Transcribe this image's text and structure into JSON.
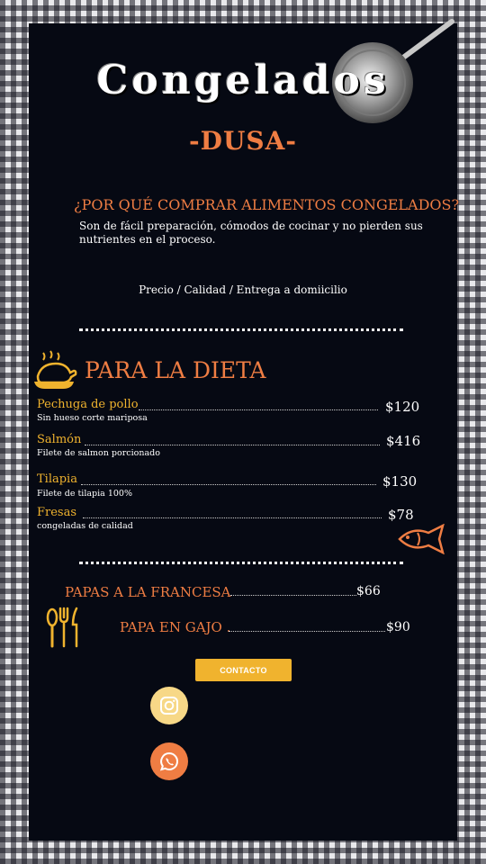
{
  "header": {
    "title": "Congelados",
    "brand": "-DUSA-"
  },
  "intro": {
    "question": "¿POR QUÉ COMPRAR ALIMENTOS CONGELADOS?",
    "body": "Son de fácil preparación, cómodos de cocinar y no pierden sus nutrientes en el proceso.",
    "tagline": "Precio / Calidad / Entrega a domiicilio"
  },
  "diet": {
    "title": "PARA LA DIETA",
    "items": [
      {
        "name": "Pechuga de pollo",
        "desc": "Sin hueso corte mariposa",
        "price": "$120"
      },
      {
        "name": "Salmón",
        "desc": "Filete de salmon porcionado",
        "price": "$416"
      },
      {
        "name": "Tilapia",
        "desc": "Filete de tilapia 100%",
        "price": "$130"
      },
      {
        "name": "Fresas",
        "desc": "congeladas de calidad",
        "price": "$78"
      }
    ]
  },
  "potatoes": {
    "items": [
      {
        "name": "PAPAS A LA FRANCESA",
        "price": "$66"
      },
      {
        "name": "PAPA EN GAJO .",
        "price": "$90"
      }
    ]
  },
  "contact": {
    "button_label": "CONTACTO",
    "icons": [
      "instagram-icon",
      "whatsapp-icon"
    ]
  },
  "colors": {
    "panel": "#060913",
    "orange": "#ef7d43",
    "yellow": "#f0b32e"
  }
}
